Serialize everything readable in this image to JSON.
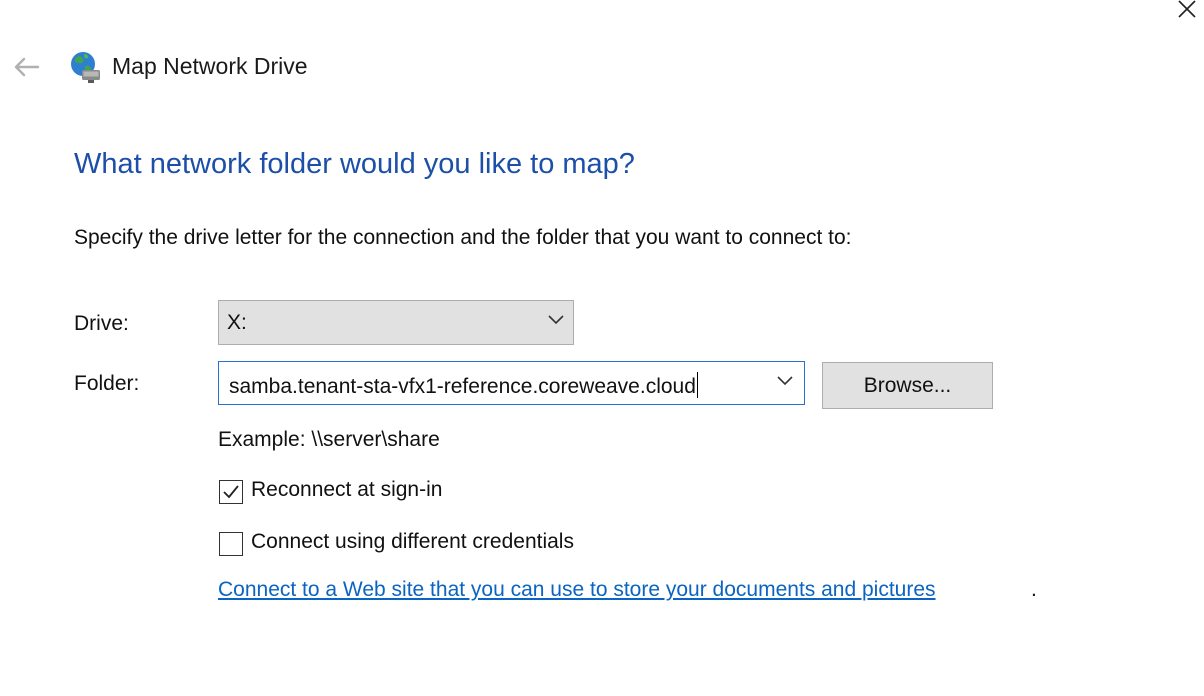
{
  "window": {
    "title": "Map Network Drive",
    "icon": "network-drive-icon",
    "close_icon": "close-icon",
    "back_icon": "back-arrow-icon"
  },
  "main": {
    "heading": "What network folder would you like to map?",
    "instruction": "Specify the drive letter for the connection and the folder that you want to connect to:",
    "drive": {
      "label": "Drive:",
      "value": "X:"
    },
    "folder": {
      "label": "Folder:",
      "value": "samba.tenant-sta-vfx1-reference.coreweave.cloud"
    },
    "browse_label": "Browse...",
    "example": "Example: \\\\server\\share",
    "reconnect": {
      "label": "Reconnect at sign-in",
      "checked": true
    },
    "different_credentials": {
      "label": "Connect using different credentials",
      "checked": false
    },
    "web_link": "Connect to a Web site that you can use to store your documents and pictures",
    "web_link_suffix": "."
  },
  "colors": {
    "heading": "#1c4fa8",
    "link": "#0a64c2",
    "focus_border": "#2b6fd6",
    "button_bg": "#e1e1e1"
  }
}
